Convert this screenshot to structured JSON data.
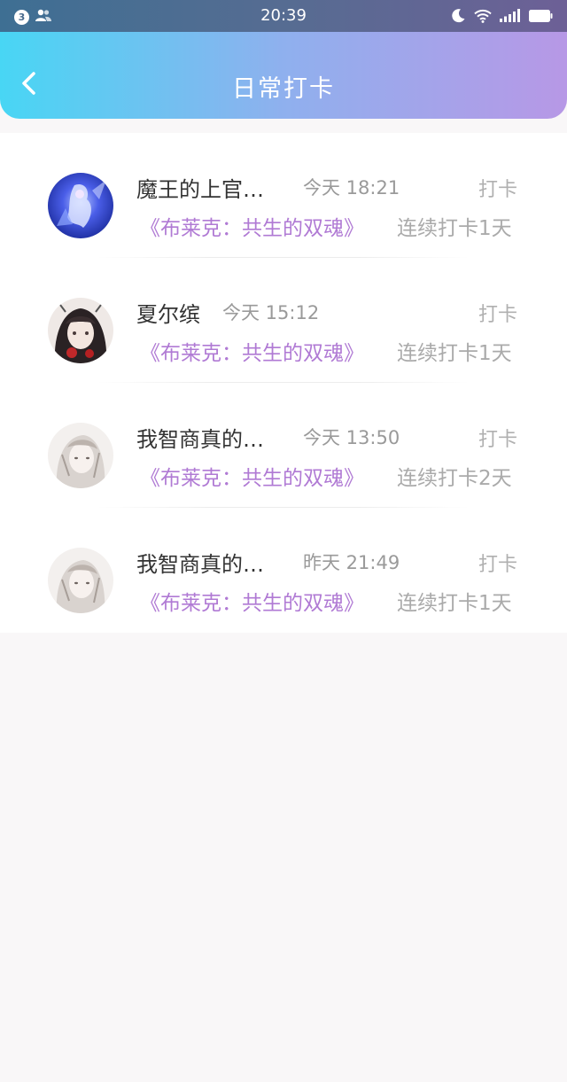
{
  "status_bar": {
    "time": "20:39",
    "notification_count": "3"
  },
  "header": {
    "title": "日常打卡"
  },
  "checkins": [
    {
      "name": "魔王的上官…",
      "time": "今天 18:21",
      "action": "打卡",
      "book": "《布莱克：共生的双魂》",
      "streak": "连续打卡1天"
    },
    {
      "name": "夏尔缤",
      "time": "今天 15:12",
      "action": "打卡",
      "book": "《布莱克：共生的双魂》",
      "streak": "连续打卡1天"
    },
    {
      "name": "我智商真的…",
      "time": "今天 13:50",
      "action": "打卡",
      "book": "《布莱克：共生的双魂》",
      "streak": "连续打卡2天"
    },
    {
      "name": "我智商真的…",
      "time": "昨天 21:49",
      "action": "打卡",
      "book": "《布莱克：共生的双魂》",
      "streak": "连续打卡1天"
    }
  ]
}
